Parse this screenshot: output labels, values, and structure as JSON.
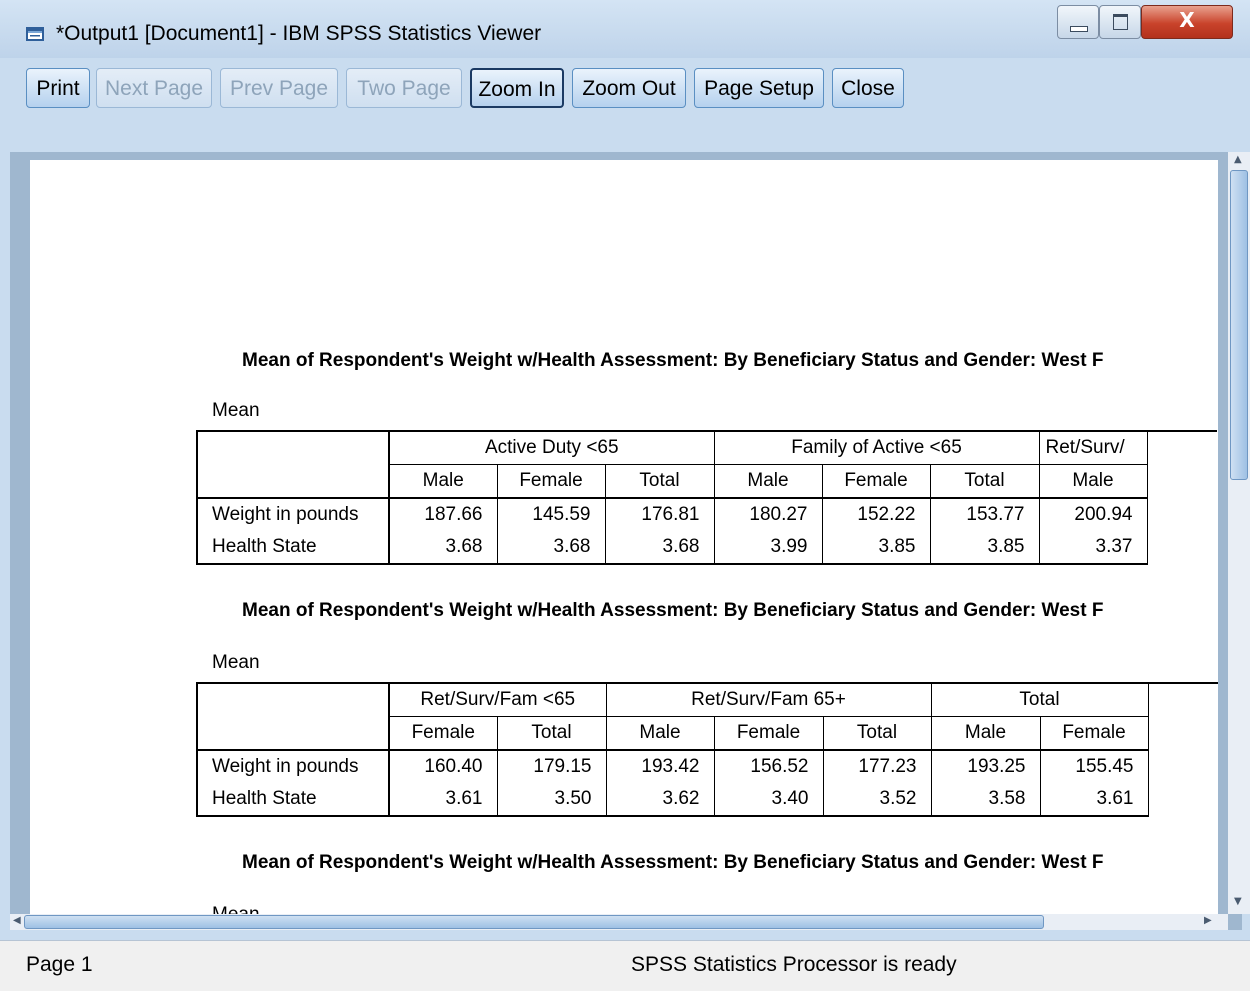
{
  "window": {
    "title": "*Output1 [Document1] - IBM SPSS Statistics Viewer",
    "close_glyph": "X",
    "close_color": "#c9432b"
  },
  "toolbar": {
    "print": "Print",
    "next_page": "Next Page",
    "prev_page": "Prev Page",
    "two_page": "Two Page",
    "zoom_in": "Zoom In",
    "zoom_out": "Zoom Out",
    "page_setup": "Page Setup",
    "close": "Close"
  },
  "tables": [
    {
      "title": "Mean of Respondent's Weight w/Health Assessment: By Beneficiary Status and Gender: West F",
      "stat_label": "Mean",
      "groups": [
        "Active Duty <65",
        "Family of Active <65",
        "Ret/Surv/"
      ],
      "columns": [
        "Male",
        "Female",
        "Total",
        "Male",
        "Female",
        "Total",
        "Male"
      ],
      "rows": [
        {
          "label": "Weight in pounds",
          "values": [
            "187.66",
            "145.59",
            "176.81",
            "180.27",
            "152.22",
            "153.77",
            "200.94"
          ]
        },
        {
          "label": "Health State",
          "values": [
            "3.68",
            "3.68",
            "3.68",
            "3.99",
            "3.85",
            "3.85",
            "3.37"
          ]
        }
      ]
    },
    {
      "title": "Mean of Respondent's Weight w/Health Assessment: By Beneficiary Status and Gender: West F",
      "stat_label": "Mean",
      "groups": [
        "Ret/Surv/Fam <65",
        "Ret/Surv/Fam 65+",
        "Total"
      ],
      "columns": [
        "Female",
        "Total",
        "Male",
        "Female",
        "Total",
        "Male",
        "Female"
      ],
      "rows": [
        {
          "label": "Weight in pounds",
          "values": [
            "160.40",
            "179.15",
            "193.42",
            "156.52",
            "177.23",
            "193.25",
            "155.45"
          ]
        },
        {
          "label": "Health State",
          "values": [
            "3.61",
            "3.50",
            "3.62",
            "3.40",
            "3.52",
            "3.58",
            "3.61"
          ]
        }
      ]
    },
    {
      "title": "Mean of Respondent's Weight w/Health Assessment: By Beneficiary Status and Gender: West F",
      "stat_label": "Mean"
    }
  ],
  "status": {
    "page": "Page 1",
    "message": "SPSS Statistics Processor is ready"
  }
}
